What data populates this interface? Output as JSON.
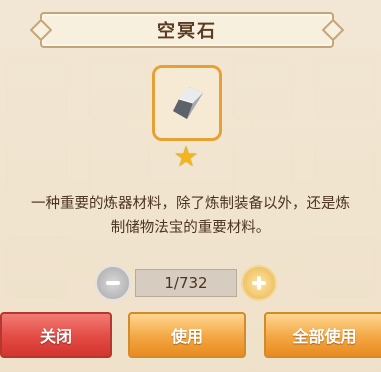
{
  "dialog": {
    "title": "空冥石",
    "item_icon": "spirit-stone-icon",
    "rarity_stars": 1,
    "description_line1": "一种重要的炼器材料，除了炼制装备以外，还是炼",
    "description_line2": "制储物法宝的重要材料。",
    "quantity_display": "1/732",
    "buttons": {
      "close": "关闭",
      "use": "使用",
      "use_all": "全部使用"
    }
  },
  "colors": {
    "accent_orange": "#f3a642",
    "close_red": "#e24b43",
    "star_gold": "#f2b51d"
  }
}
